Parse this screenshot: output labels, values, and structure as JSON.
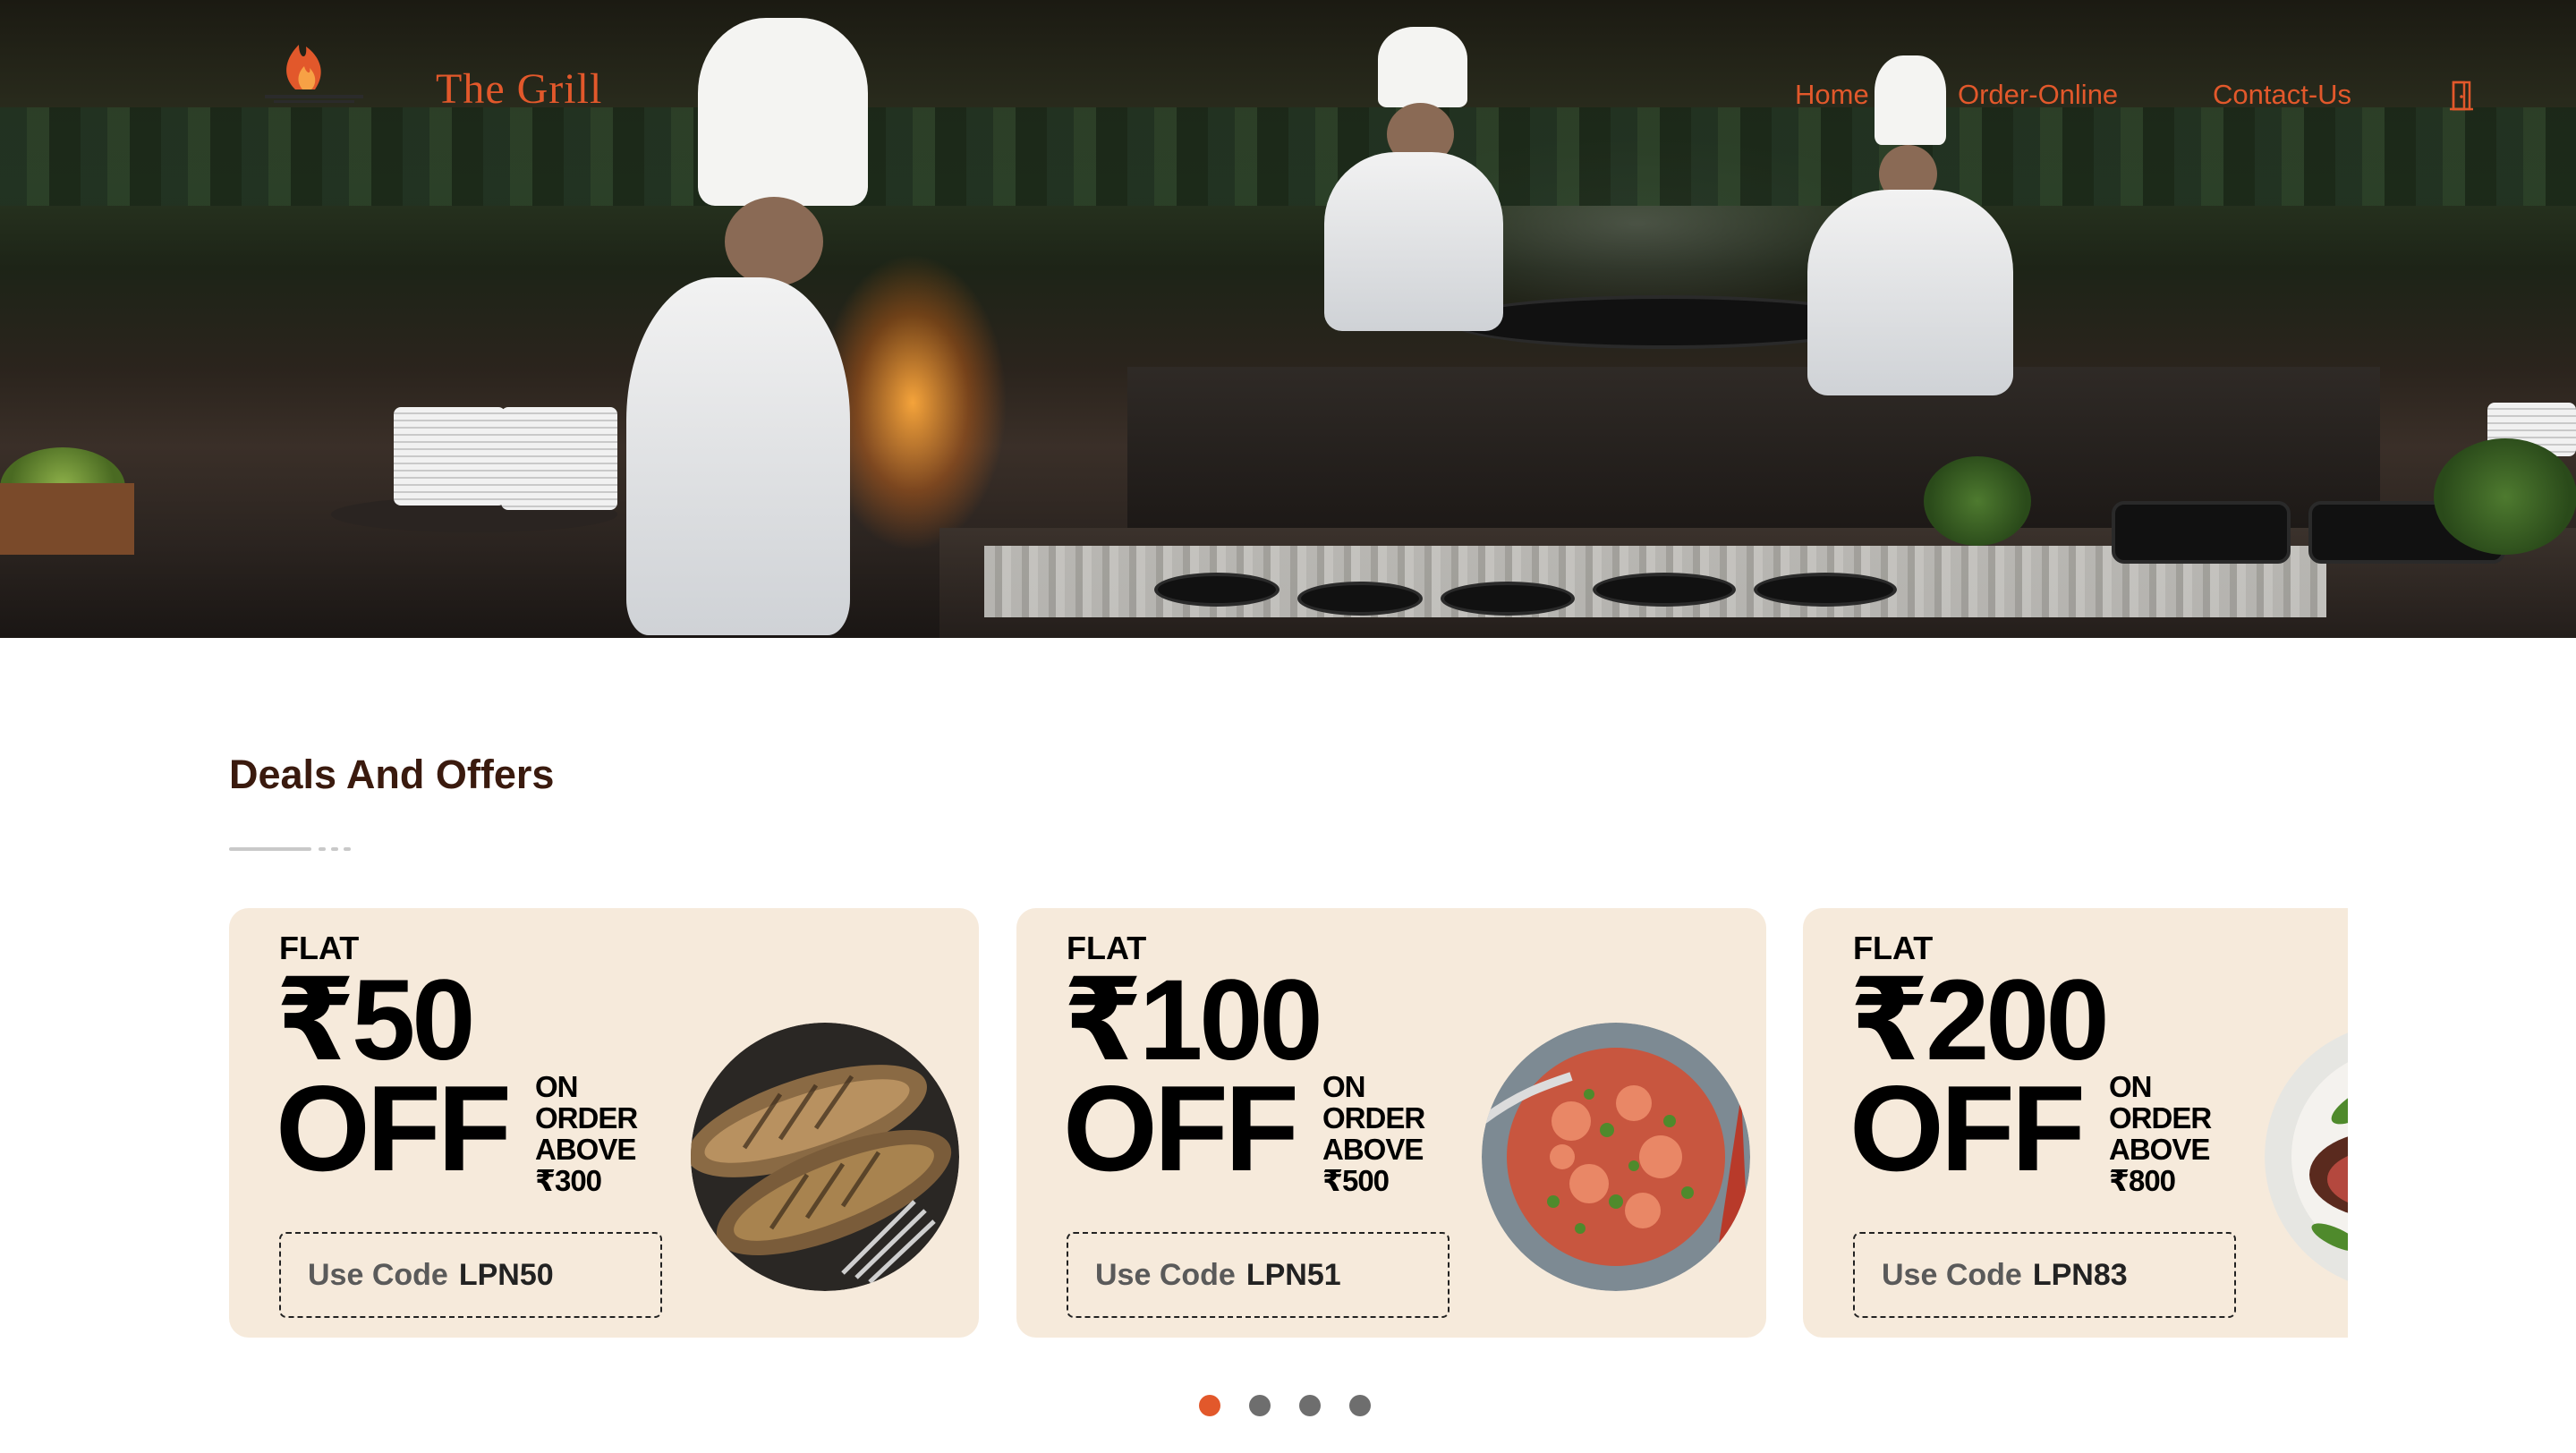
{
  "colors": {
    "accent": "#e2582b",
    "heading": "#3a1a0e",
    "card_bg": "#f6eadb",
    "dot_inactive": "#6e6e6e"
  },
  "header": {
    "logo_icon": "flame-grill-logo",
    "brand": "The Grill",
    "nav": [
      {
        "label": "Home"
      },
      {
        "label": "Order-Online"
      },
      {
        "label": "Contact-Us"
      }
    ],
    "exit_icon": "door-exit-icon"
  },
  "deals": {
    "title": "Deals And Offers",
    "cards": [
      {
        "flat": "FLAT",
        "amount": "₹50",
        "off": "OFF",
        "cond": [
          "ON",
          "ORDER",
          "ABOVE",
          "₹300"
        ],
        "code_label": "Use Code",
        "code": "LPN50",
        "image": "grilled-fish"
      },
      {
        "flat": "FLAT",
        "amount": "₹100",
        "off": "OFF",
        "cond": [
          "ON",
          "ORDER",
          "ABOVE",
          "₹500"
        ],
        "code_label": "Use Code",
        "code": "LPN51",
        "image": "poke-bowl"
      },
      {
        "flat": "FLAT",
        "amount": "₹200",
        "off": "OFF",
        "cond": [
          "ON",
          "ORDER",
          "ABOVE",
          "₹800"
        ],
        "code_label": "Use Code",
        "code": "LPN83",
        "image": "steak-plate"
      }
    ],
    "carousel": {
      "pages": 4,
      "active_index": 0
    }
  }
}
